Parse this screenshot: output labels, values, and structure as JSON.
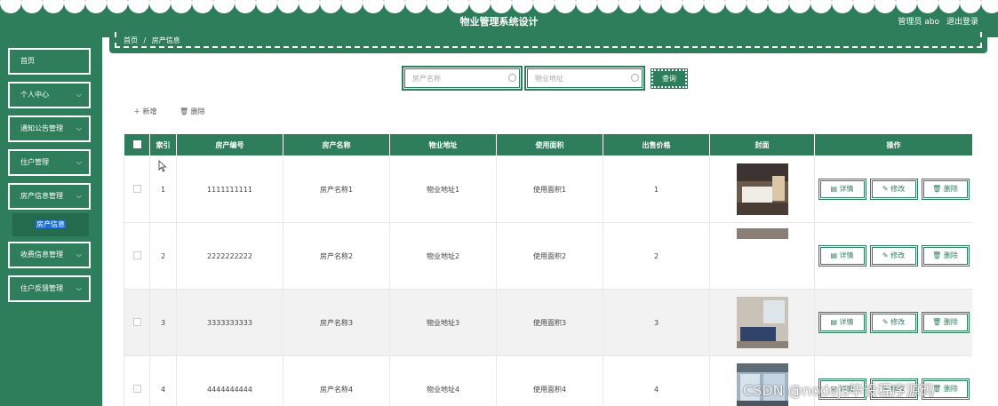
{
  "header": {
    "title": "物业管理系统设计",
    "user": "管理员 abo",
    "logout": "退出登录"
  },
  "sidebar": {
    "items": [
      {
        "label": "首页",
        "has_children": false
      },
      {
        "label": "个人中心",
        "has_children": true
      },
      {
        "label": "通知公告管理",
        "has_children": true
      },
      {
        "label": "住户管理",
        "has_children": true
      },
      {
        "label": "房产信息管理",
        "has_children": true
      },
      {
        "label": "收费信息管理",
        "has_children": true
      },
      {
        "label": "住户反馈管理",
        "has_children": true
      }
    ],
    "submenu": {
      "label": "房产信息"
    }
  },
  "breadcrumb": {
    "home": "首页",
    "sep": "/",
    "current": "房产信息"
  },
  "search": {
    "name_placeholder": "房产名称",
    "address_placeholder": "物业地址",
    "button": "查询"
  },
  "actions": {
    "add": "新增",
    "delete": "删除"
  },
  "table": {
    "headers": [
      "索引",
      "房产编号",
      "房产名称",
      "物业地址",
      "使用面积",
      "出售价格",
      "封面",
      "操作"
    ],
    "rows": [
      {
        "index": "1",
        "code": "1111111111",
        "name": "房产名称1",
        "address": "物业地址1",
        "area": "使用面积1",
        "price": "1"
      },
      {
        "index": "2",
        "code": "2222222222",
        "name": "房产名称2",
        "address": "物业地址2",
        "area": "使用面积2",
        "price": "2"
      },
      {
        "index": "3",
        "code": "3333333333",
        "name": "房产名称3",
        "address": "物业地址3",
        "area": "使用面积3",
        "price": "3"
      },
      {
        "index": "4",
        "code": "4444444444",
        "name": "房产名称4",
        "address": "物业地址4",
        "area": "使用面积4",
        "price": "4"
      }
    ],
    "ops": {
      "detail": "详情",
      "edit": "修改",
      "delete": "删除"
    }
  },
  "watermark": "CSDN @nodejs毕设程序源码",
  "colors": {
    "primary": "#2e7d5b",
    "white": "#ffffff"
  }
}
